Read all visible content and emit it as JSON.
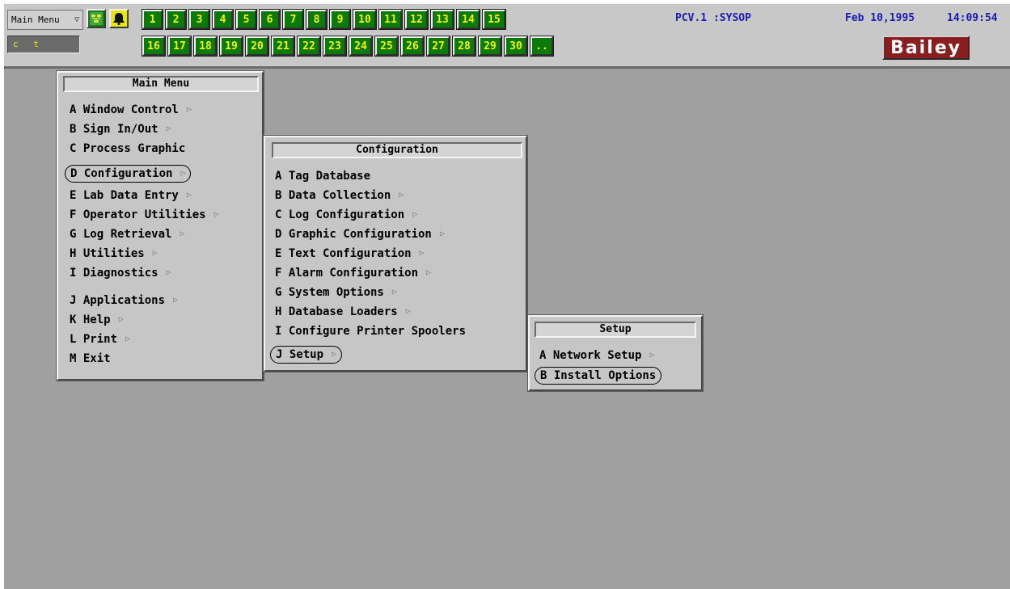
{
  "topbar": {
    "menu_select": "Main Menu",
    "command_field": "c t",
    "row1_buttons": [
      "1",
      "2",
      "3",
      "4",
      "5",
      "6",
      "7",
      "8",
      "9",
      "10",
      "11",
      "12",
      "13",
      "14",
      "15"
    ],
    "row2_buttons": [
      "16",
      "17",
      "18",
      "19",
      "20",
      "21",
      "22",
      "23",
      "24",
      "25",
      "26",
      "27",
      "28",
      "29",
      "30",
      ".."
    ],
    "node": "PCV.1 :SYSOP",
    "date": "Feb 10,1995",
    "time": "14:09:54",
    "logo": "Bailey"
  },
  "main_menu": {
    "title": "Main Menu",
    "items": [
      {
        "label": "A Window Control",
        "submenu": true
      },
      {
        "label": "B Sign In/Out",
        "submenu": true
      },
      {
        "label": "C Process Graphic",
        "submenu": false
      },
      {
        "label": "D Configuration",
        "submenu": true,
        "selected": true
      },
      {
        "label": "E Lab Data Entry",
        "submenu": true
      },
      {
        "label": "F Operator Utilities",
        "submenu": true
      },
      {
        "label": "G Log Retrieval",
        "submenu": true
      },
      {
        "label": "H Utilities",
        "submenu": true
      },
      {
        "label": "I Diagnostics",
        "submenu": true
      },
      {
        "label": "J Applications",
        "submenu": true
      },
      {
        "label": "K Help",
        "submenu": true
      },
      {
        "label": "L Print",
        "submenu": true
      },
      {
        "label": "M Exit",
        "submenu": false
      }
    ]
  },
  "config_menu": {
    "title": "Configuration",
    "items": [
      {
        "label": "A Tag Database",
        "submenu": false
      },
      {
        "label": "B Data Collection",
        "submenu": true
      },
      {
        "label": "C Log Configuration",
        "submenu": true
      },
      {
        "label": "D Graphic Configuration",
        "submenu": true
      },
      {
        "label": "E Text Configuration",
        "submenu": true
      },
      {
        "label": "F Alarm Configuration",
        "submenu": true
      },
      {
        "label": "G System Options",
        "submenu": true
      },
      {
        "label": "H Database Loaders",
        "submenu": true
      },
      {
        "label": "I Configure Printer Spoolers",
        "submenu": false
      },
      {
        "label": "J Setup",
        "submenu": true,
        "selected": true
      }
    ]
  },
  "setup_menu": {
    "title": "Setup",
    "items": [
      {
        "label": "A Network Setup",
        "submenu": true
      },
      {
        "label": "B Install Options",
        "submenu": false,
        "selected": true
      }
    ]
  },
  "colors": {
    "background": "#a0a0a0",
    "button_green": "#0a7a0a",
    "button_text": "#f4f400",
    "header_text": "#1a1ab4",
    "logo_bg": "#8a1e1e"
  },
  "icons": [
    "network-status-icon",
    "alarm-bell-icon",
    "submenu-arrow-icon",
    "dropdown-arrow-icon"
  ]
}
